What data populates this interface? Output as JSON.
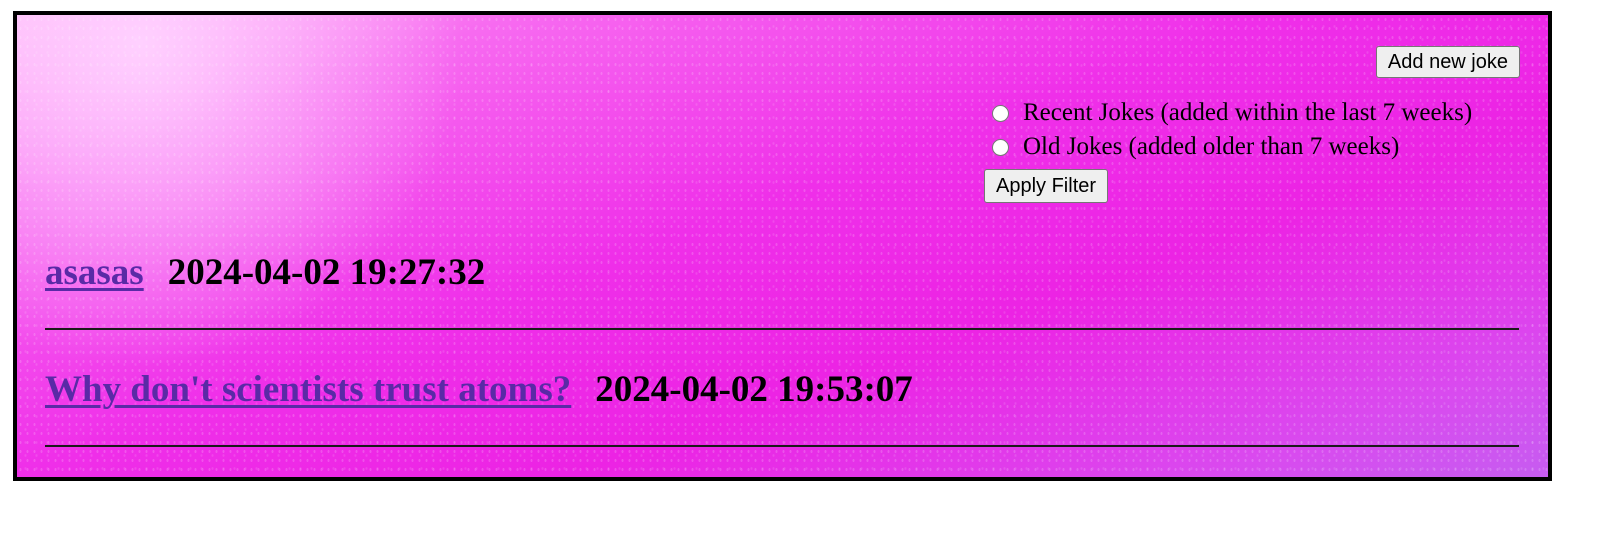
{
  "header": {
    "add_button_label": "Add new joke"
  },
  "filter": {
    "options": [
      {
        "label": "Recent Jokes (added within the last 7 weeks)",
        "selected": false
      },
      {
        "label": "Old Jokes (added older than 7 weeks)",
        "selected": false
      }
    ],
    "apply_button_label": "Apply Filter"
  },
  "jokes": [
    {
      "title": "asasas",
      "timestamp": "2024-04-02 19:27:32"
    },
    {
      "title": "Why don't scientists trust atoms?",
      "timestamp": "2024-04-02 19:53:07"
    }
  ],
  "colors": {
    "link": "#5a2aa6",
    "background_pink": "#ec23e4",
    "background_purple": "#c65cf0",
    "border": "#000000"
  }
}
